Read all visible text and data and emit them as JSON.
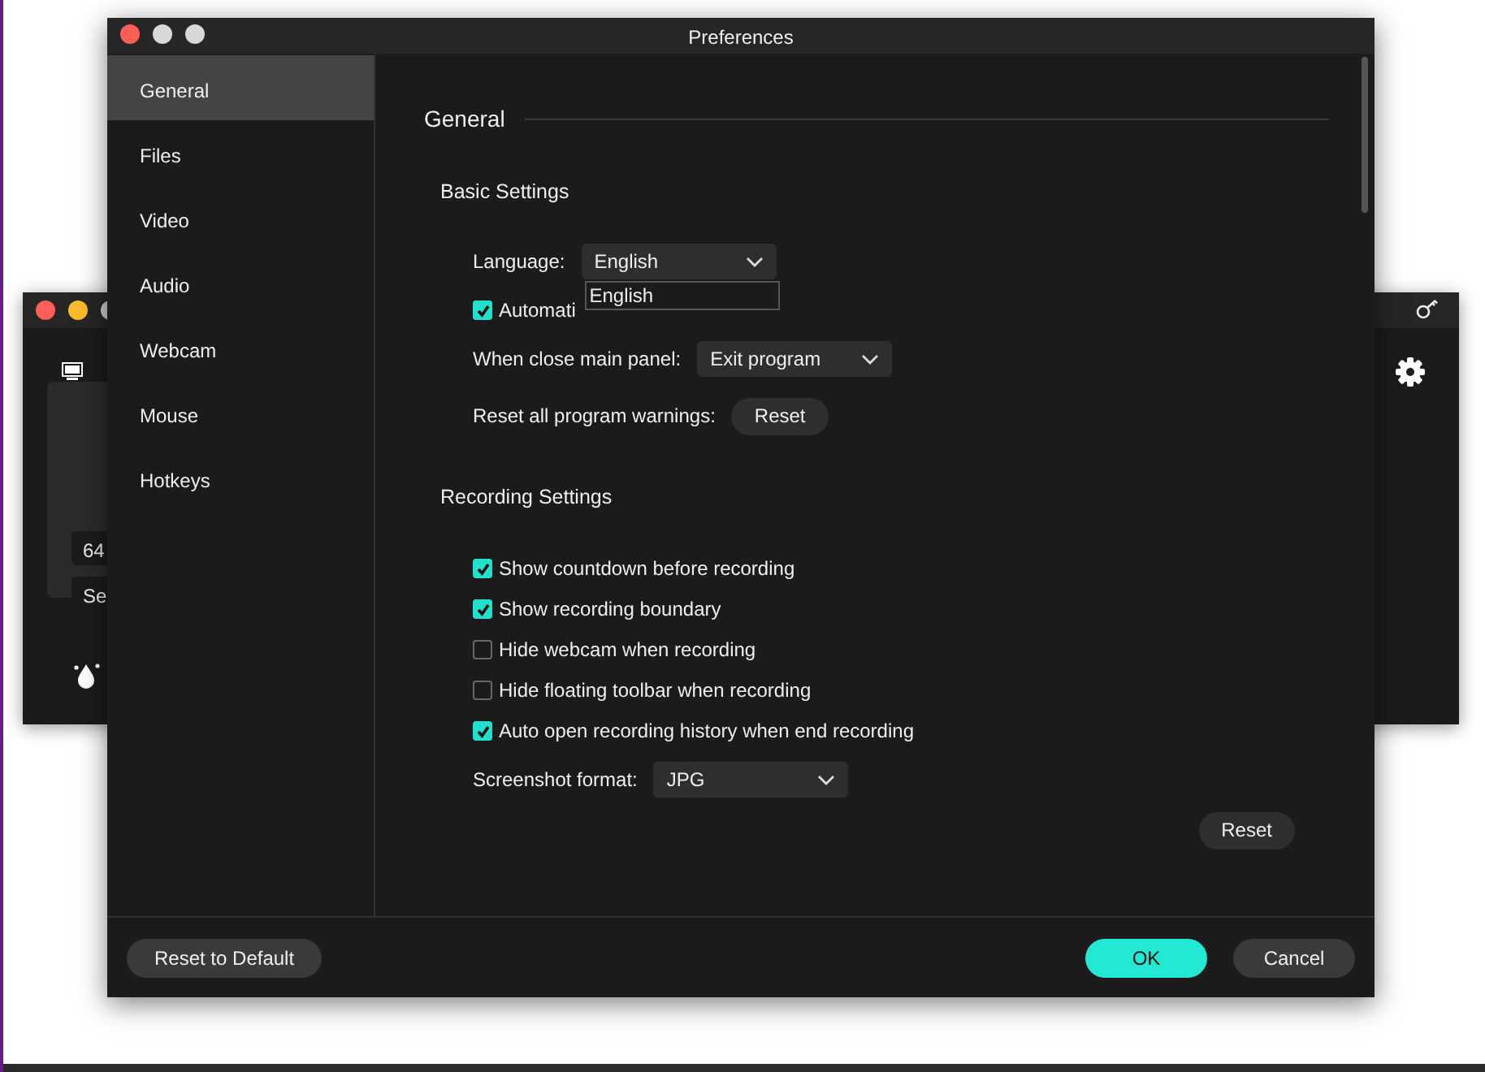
{
  "background_window": {
    "fields": [
      "64",
      "Se"
    ]
  },
  "preferences_window": {
    "title": "Preferences",
    "sidebar": {
      "items": [
        {
          "label": "General",
          "selected": true
        },
        {
          "label": "Files",
          "selected": false
        },
        {
          "label": "Video",
          "selected": false
        },
        {
          "label": "Audio",
          "selected": false
        },
        {
          "label": "Webcam",
          "selected": false
        },
        {
          "label": "Mouse",
          "selected": false
        },
        {
          "label": "Hotkeys",
          "selected": false
        }
      ]
    },
    "section_title": "General",
    "basic_settings": {
      "title": "Basic Settings",
      "rows": [
        {
          "kind": "select",
          "label": "Language:",
          "value": "English",
          "expanded": true,
          "options": [
            "English"
          ]
        },
        {
          "kind": "checkbox",
          "label": "Automati",
          "checked": true
        },
        {
          "kind": "select",
          "label": "When close main panel:",
          "value": "Exit program"
        },
        {
          "kind": "button",
          "label": "Reset all program warnings:",
          "button": "Reset"
        }
      ]
    },
    "recording_settings": {
      "title": "Recording Settings",
      "rows": [
        {
          "kind": "checkbox",
          "label": "Show countdown before recording",
          "checked": true
        },
        {
          "kind": "checkbox",
          "label": "Show recording boundary",
          "checked": true
        },
        {
          "kind": "checkbox",
          "label": "Hide webcam when recording",
          "checked": false
        },
        {
          "kind": "checkbox",
          "label": "Hide floating toolbar when recording",
          "checked": false
        },
        {
          "kind": "checkbox",
          "label": "Auto open recording history when end recording",
          "checked": true
        },
        {
          "kind": "select",
          "label": "Screenshot format:",
          "value": "JPG"
        }
      ],
      "reset_button": "Reset"
    },
    "footer": {
      "reset_default": "Reset to Default",
      "ok": "OK",
      "cancel": "Cancel"
    }
  }
}
